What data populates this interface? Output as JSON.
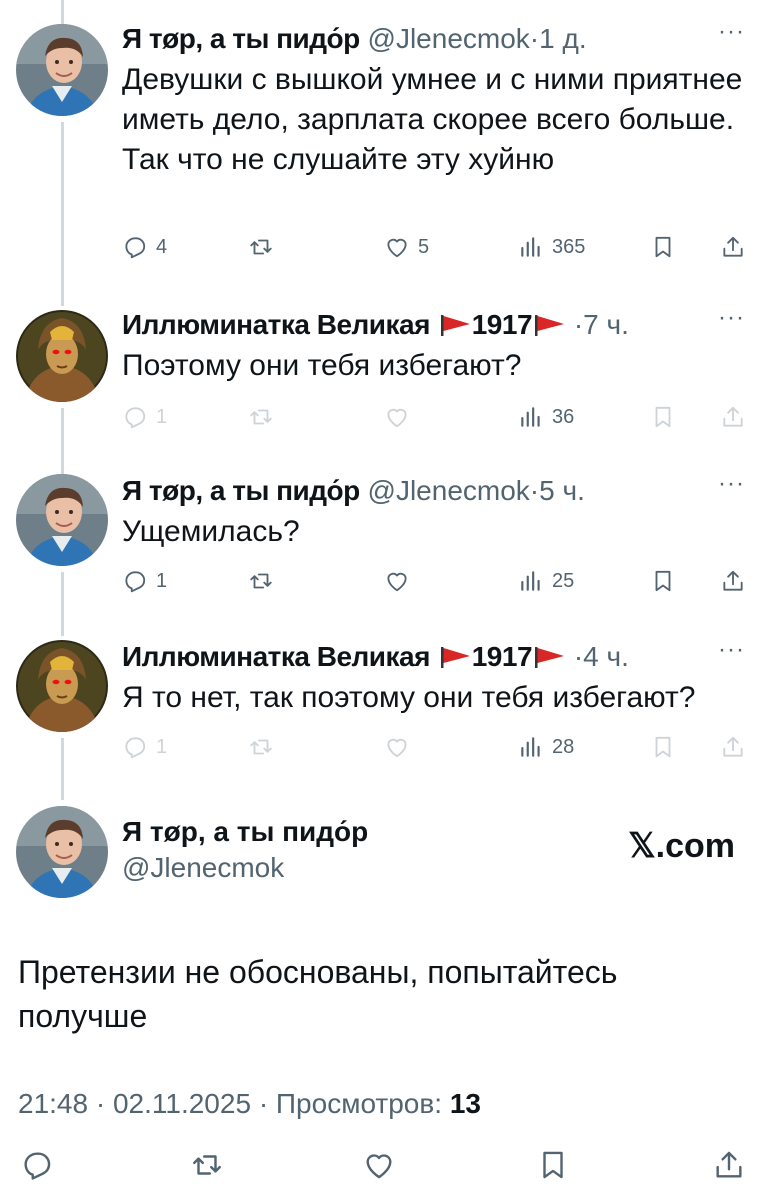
{
  "tweets": [
    {
      "name": "Я тøр, а ты пидо́р",
      "handle": "@Jlenecmok",
      "time": "1 д.",
      "text": "Девушки с вышкой умнее и с ними приятнее иметь дело, зарплата скорее всего больше. Так что не слушайте эту хуйню",
      "replies": "4",
      "retweets": "",
      "likes": "5",
      "views": "365"
    },
    {
      "name": "Иллюминатка Великая",
      "flag_text": "1917",
      "time": "7 ч.",
      "text": "Поэтому они тебя избегают?",
      "replies": "1",
      "retweets": "",
      "likes": "",
      "views": "36"
    },
    {
      "name": "Я тøр, а ты пидо́р",
      "handle": "@Jlenecmok",
      "time": "5 ч.",
      "text": "Ущемилась?",
      "replies": "1",
      "retweets": "",
      "likes": "",
      "views": "25"
    },
    {
      "name": "Иллюминатка Великая",
      "flag_text": "1917",
      "time": "4 ч.",
      "text": "Я то нет, так поэтому они тебя избегают?",
      "replies": "1",
      "retweets": "",
      "likes": "",
      "views": "28"
    }
  ],
  "main": {
    "name": "Я тøр, а ты пидо́р",
    "handle": "@Jlenecmok",
    "site": "𝕏.com",
    "text": "Претензии не обоснованы, попытайтесь получше",
    "time": "21:48",
    "date": "02.11.2025",
    "views_label": "Просмотров:",
    "views": "13"
  },
  "sep": "·",
  "more": "···",
  "colors": {
    "icon": "#536471",
    "line": "#cfd9de",
    "flag": "#d92626"
  }
}
